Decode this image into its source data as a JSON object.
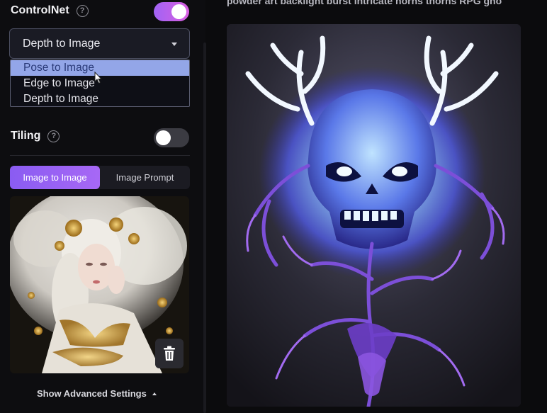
{
  "controlnet": {
    "label": "ControlNet",
    "enabled": true,
    "selected_value": "Depth to Image",
    "options": [
      "Pose to Image",
      "Edge to Image",
      "Depth to Image"
    ],
    "highlighted_option": "Pose to Image"
  },
  "tiling": {
    "label": "Tiling",
    "enabled": false
  },
  "tabs": {
    "image_to_image": "Image to Image",
    "image_prompt": "Image Prompt",
    "active": "Image to Image"
  },
  "icons": {
    "help": "question-circle-icon",
    "trash": "trash-icon",
    "caret": "chevron-down-icon"
  },
  "footer": {
    "advanced_label": "Show Advanced Settings"
  },
  "prompt": {
    "visible_text": "powder art backlight burst intricate horns thorns RPG gho"
  },
  "colors": {
    "accent_purple": "#a163f5",
    "accent_pink": "#d95fe0",
    "selected_option_bg": "#93a6e8",
    "panel_bg": "#0d0d10"
  }
}
